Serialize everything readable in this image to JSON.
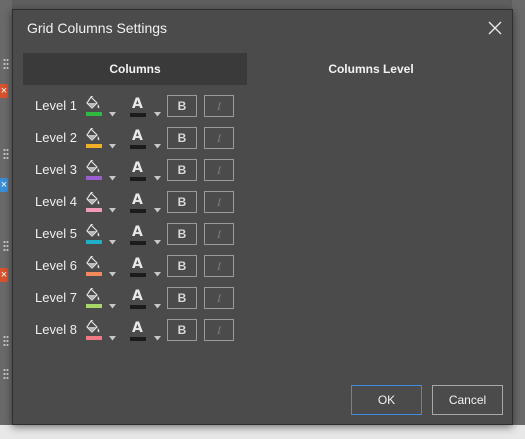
{
  "dialog": {
    "title": "Grid Columns Settings",
    "close_icon": "close-icon"
  },
  "tabs": [
    {
      "label": "Columns",
      "active": true
    },
    {
      "label": "Columns Level",
      "active": false
    }
  ],
  "levels": [
    {
      "label": "Level 1",
      "fill_color": "#2fb843"
    },
    {
      "label": "Level 2",
      "fill_color": "#f0b02a"
    },
    {
      "label": "Level 3",
      "fill_color": "#9b5fd1"
    },
    {
      "label": "Level 4",
      "fill_color": "#f29bb7"
    },
    {
      "label": "Level 5",
      "fill_color": "#1fb0c8"
    },
    {
      "label": "Level 6",
      "fill_color": "#f28a5e"
    },
    {
      "label": "Level 7",
      "fill_color": "#a9d66a"
    },
    {
      "label": "Level 8",
      "fill_color": "#f07a86"
    }
  ],
  "format": {
    "font_letter": "A",
    "font_color": "#1c1c1c",
    "bold_label": "B",
    "italic_label": "I"
  },
  "buttons": {
    "ok": "OK",
    "cancel": "Cancel"
  },
  "colors": {
    "dialog_bg": "#4b4b4b",
    "active_tab_bg": "#3a3a3a",
    "ok_border": "#3d8ee0"
  }
}
